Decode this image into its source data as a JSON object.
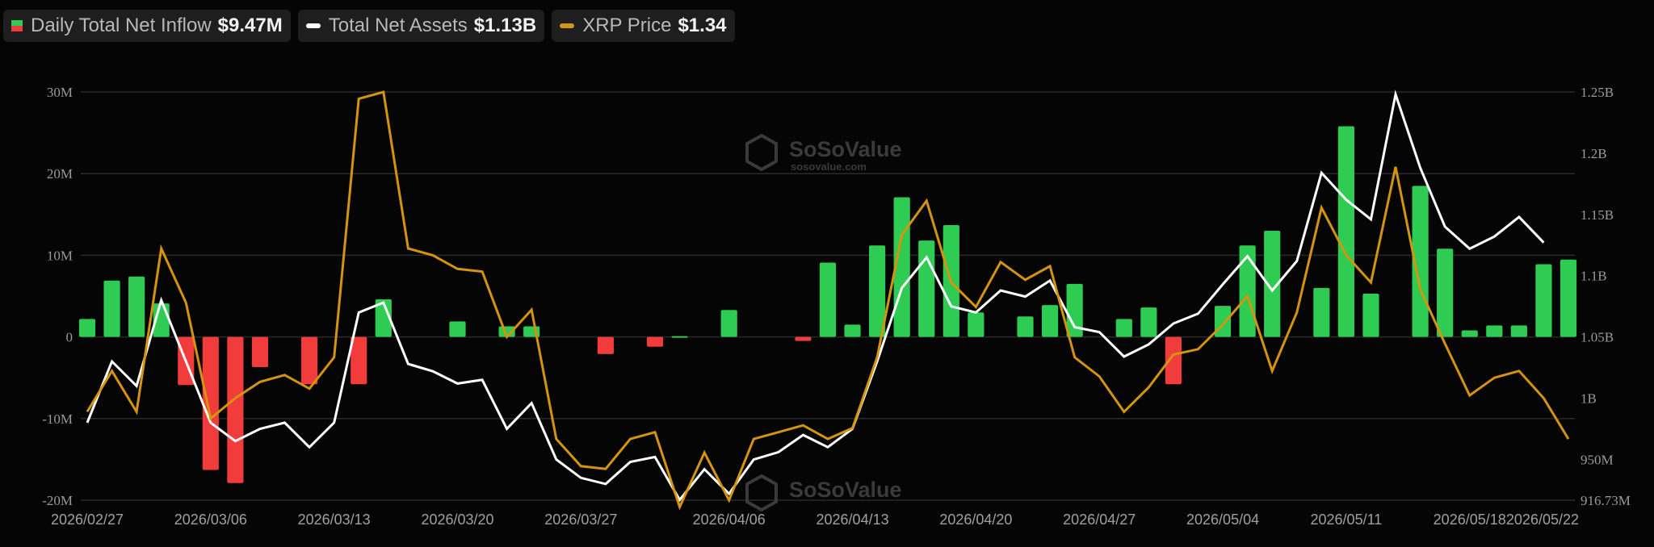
{
  "legend": {
    "flow_label": "Daily Total Net Inflow",
    "flow_value": "$9.47M",
    "assets_label": "Total Net Assets",
    "assets_value": "$1.13B",
    "price_label": "XRP Price",
    "price_value": "$1.34"
  },
  "watermark": {
    "brand": "SoSoValue",
    "site": "sosovalue.com"
  },
  "colors": {
    "inflow_positive": "#2ecc52",
    "inflow_negative": "#f23b3b",
    "assets_line": "#ffffff",
    "price_line": "#d4940f",
    "grid": "#2a2a2a",
    "background": "#050505"
  },
  "chart_data": {
    "type": "bar",
    "x": [
      "2026/02/27",
      "2026/03/02",
      "2026/03/03",
      "2026/03/04",
      "2026/03/05",
      "2026/03/06",
      "2026/03/09",
      "2026/03/10",
      "2026/03/11",
      "2026/03/12",
      "2026/03/13",
      "2026/03/16",
      "2026/03/17",
      "2026/03/18",
      "2026/03/19",
      "2026/03/20",
      "2026/03/23",
      "2026/03/24",
      "2026/03/25",
      "2026/03/26",
      "2026/03/27",
      "2026/03/30",
      "2026/03/31",
      "2026/04/01",
      "2026/04/02",
      "2026/04/03",
      "2026/04/06",
      "2026/04/07",
      "2026/04/08",
      "2026/04/09",
      "2026/04/10",
      "2026/04/13",
      "2026/04/14",
      "2026/04/15",
      "2026/04/16",
      "2026/04/17",
      "2026/04/20",
      "2026/04/21",
      "2026/04/22",
      "2026/04/23",
      "2026/04/24",
      "2026/04/27",
      "2026/04/28",
      "2026/04/29",
      "2026/04/30",
      "2026/05/01",
      "2026/05/04",
      "2026/05/05",
      "2026/05/06",
      "2026/05/07",
      "2026/05/08",
      "2026/05/11",
      "2026/05/12",
      "2026/05/13",
      "2026/05/14",
      "2026/05/15",
      "2026/05/18",
      "2026/05/19",
      "2026/05/20",
      "2026/05/21",
      "2026/05/22"
    ],
    "x_tick_labels": [
      "2026/02/27",
      "2026/03/06",
      "2026/03/13",
      "2026/03/20",
      "2026/03/27",
      "2026/04/06",
      "2026/04/13",
      "2026/04/20",
      "2026/04/27",
      "2026/05/04",
      "2026/05/11",
      "2026/05/18",
      "2026/05/22"
    ],
    "series": [
      {
        "name": "Daily Total Net Inflow",
        "type": "bar",
        "axis": "left",
        "values": [
          2.2,
          6.9,
          7.4,
          4.1,
          -5.9,
          -16.3,
          -17.9,
          -3.7,
          0,
          -5.8,
          0,
          -5.8,
          4.6,
          0,
          0,
          1.9,
          0,
          1.3,
          1.3,
          0,
          0,
          -2.1,
          0,
          -1.2,
          0.1,
          0,
          3.3,
          0,
          0,
          -0.5,
          9.1,
          1.5,
          11.2,
          17.1,
          11.8,
          13.7,
          3.0,
          0,
          2.5,
          3.9,
          6.5,
          0,
          2.2,
          3.6,
          -5.8,
          0,
          3.8,
          11.2,
          13.0,
          0,
          6.0,
          25.8,
          5.3,
          0,
          18.5,
          10.8,
          0.8,
          1.4,
          1.4,
          8.9,
          9.47
        ]
      },
      {
        "name": "Total Net Assets",
        "type": "line",
        "axis": "right",
        "values": [
          0.98,
          1.03,
          1.01,
          1.08,
          null,
          0.98,
          0.965,
          0.975,
          0.98,
          0.96,
          0.98,
          1.07,
          1.078,
          1.028,
          1.022,
          1.012,
          1.015,
          0.975,
          0.996,
          0.95,
          0.935,
          0.93,
          0.948,
          0.952,
          0.917,
          0.942,
          0.922,
          0.95,
          0.956,
          0.97,
          0.96,
          0.975,
          1.03,
          1.09,
          1.115,
          1.075,
          1.07,
          1.088,
          1.083,
          1.096,
          1.058,
          1.054,
          1.034,
          1.044,
          1.061,
          1.069,
          1.093,
          1.116,
          1.088,
          1.112,
          1.184,
          1.162,
          1.146,
          1.248,
          1.188,
          1.14,
          1.122,
          1.132,
          1.148,
          1.127
        ]
      },
      {
        "name": "XRP Price",
        "type": "line",
        "axis": "price",
        "values": [
          1.33,
          1.36,
          1.33,
          1.45,
          1.41,
          1.325,
          1.34,
          1.352,
          1.357,
          1.347,
          1.37,
          1.56,
          1.565,
          1.45,
          1.445,
          1.435,
          1.433,
          1.385,
          1.405,
          1.31,
          1.29,
          1.288,
          1.31,
          1.315,
          1.26,
          1.3,
          1.265,
          1.31,
          1.315,
          1.32,
          1.31,
          1.318,
          1.37,
          1.46,
          1.485,
          1.425,
          1.407,
          1.44,
          1.427,
          1.437,
          1.37,
          1.356,
          1.33,
          1.348,
          1.372,
          1.376,
          1.394,
          1.415,
          1.36,
          1.403,
          1.48,
          1.445,
          1.425,
          1.51,
          1.42,
          1.38,
          1.342,
          1.355,
          1.36,
          1.34,
          1.31
        ]
      }
    ],
    "y_left": {
      "ticks": [
        -20,
        -10,
        0,
        10,
        20,
        30
      ],
      "tick_labels": [
        "-20M",
        "-10M",
        "0",
        "10M",
        "20M",
        "30M"
      ],
      "range": [
        -20,
        30
      ]
    },
    "y_right": {
      "ticks": [
        0.91673,
        0.95,
        1.0,
        1.05,
        1.1,
        1.15,
        1.2,
        1.25
      ],
      "tick_labels": [
        "916.73M",
        "950M",
        "1B",
        "1.05B",
        "1.1B",
        "1.15B",
        "1.2B",
        "1.25B"
      ],
      "range": [
        0.91673,
        1.25
      ]
    },
    "y_price_range": [
      1.265,
      1.565
    ],
    "grid": true,
    "legend_position": "top-left"
  }
}
